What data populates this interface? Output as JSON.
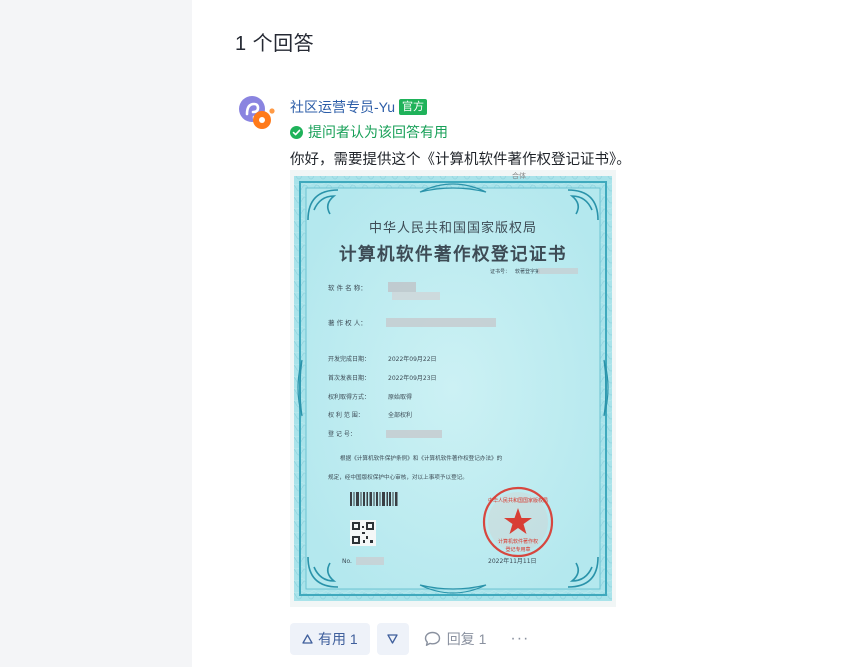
{
  "answers": {
    "count_label": "1 个回答"
  },
  "answer": {
    "author_name": "社区运营专员-Yu",
    "official_badge": "官方",
    "accepted_label": "提问者认为该回答有用",
    "body_text": "你好，需要提供这个《计算机软件著作权登记证书》。",
    "certificate": {
      "top_mark": "合体",
      "title_line1": "中华人民共和国国家版权局",
      "title_line2": "计算机软件著作权登记证书",
      "cert_no_label": "证书号：",
      "cert_no_value": "软著登字第",
      "software_name_label": "软 件 名 称：",
      "owner_label": "著 作 权 人：",
      "dev_date_label": "开发完成日期：",
      "dev_date_value": "2022年09月22日",
      "publish_date_label": "首次发表日期：",
      "publish_date_value": "2022年09月23日",
      "acquire_label": "权利取得方式：",
      "acquire_value": "原始取得",
      "scope_label": "权 利 范 围：",
      "scope_value": "全部权利",
      "reg_no_label": "登 记 号：",
      "statement_line1": "根据《计算机软件保护条例》和《计算机软件著作权登记办法》的",
      "statement_line2": "规定，经中国版权保护中心审核，对以上事项予以登记。",
      "serial_label": "No.",
      "issue_date": "2022年11月11日",
      "seal_text_top": "中华人民共和国国家版权局",
      "seal_text_bottom1": "计算机软件著作权",
      "seal_text_bottom2": "登记专用章"
    },
    "actions": {
      "useful_label": "有用 1",
      "reply_label": "回复 1",
      "more_label": "···"
    }
  },
  "colors": {
    "left_rail": "#f4f5f7",
    "official_green": "#1fb25a",
    "action_blue": "#3f5f9c",
    "seal_red": "#d9352b",
    "cert_border": "#55b8c9"
  },
  "icons": {
    "avatar": "orange-purple-logo-avatar",
    "accepted": "check-circle-icon",
    "useful": "triangle-up-icon",
    "downvote": "triangle-down-icon",
    "reply": "comment-bubble-icon",
    "more": "ellipsis-icon"
  }
}
